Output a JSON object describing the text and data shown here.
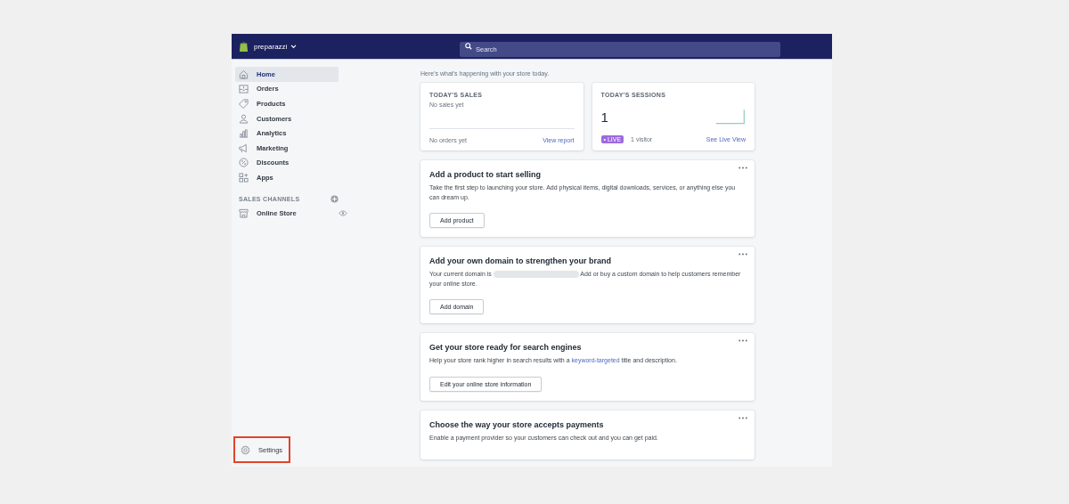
{
  "top_bar": {
    "store_name": "preparazzi",
    "search": {
      "placeholder": "Search"
    }
  },
  "sidebar": {
    "items": [
      {
        "label": "Home",
        "selected": true
      },
      {
        "label": "Orders",
        "selected": false
      },
      {
        "label": "Products",
        "selected": false
      },
      {
        "label": "Customers",
        "selected": false
      },
      {
        "label": "Analytics",
        "selected": false
      },
      {
        "label": "Marketing",
        "selected": false
      },
      {
        "label": "Discounts",
        "selected": false
      },
      {
        "label": "Apps",
        "selected": false
      }
    ],
    "sales_channels": {
      "heading": "SALES CHANNELS",
      "items": [
        {
          "label": "Online Store"
        }
      ]
    },
    "settings": {
      "label": "Settings",
      "highlighted": true
    }
  },
  "main": {
    "subtitle": "Here's what's happening with your store today.",
    "stats": [
      {
        "kind": "sales",
        "title": "TODAY'S SALES",
        "value": "No sales yet",
        "footer": "No orders yet",
        "link": "View report"
      },
      {
        "kind": "sessions",
        "title": "TODAY'S SESSIONS",
        "value": "1",
        "badge": "• LIVE",
        "footer": "1 visitor",
        "link": "See Live View"
      }
    ],
    "cards": [
      {
        "kind": "plain",
        "title": "Add a product to start selling",
        "text": "Take the first step to launching your store. Add physical items, digital downloads, services, or anything else you can dream up.",
        "button": "Add product"
      },
      {
        "kind": "redacted",
        "title": "Add your own domain to strengthen your brand",
        "text_before": "Your current domain is",
        "text": "Add or buy a custom domain to help customers remember your online store.",
        "button": "Add domain"
      },
      {
        "kind": "link",
        "title": "Get your store ready for search engines",
        "text_before": "Help your store rank higher in search results with a",
        "link": "keyword-targeted",
        "text": "title and description.",
        "button": "Edit your online store information"
      },
      {
        "kind": "plain",
        "title": "Choose the way your store accepts payments",
        "text": "Enable a payment provider so your customers can check out and you can get paid."
      }
    ]
  }
}
